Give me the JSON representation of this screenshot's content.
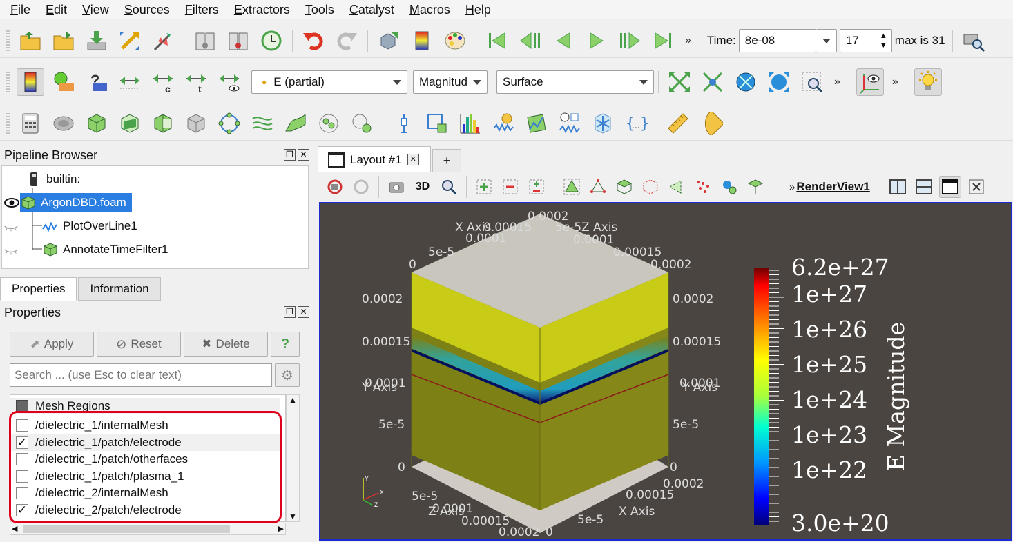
{
  "menu": [
    "File",
    "Edit",
    "View",
    "Sources",
    "Filters",
    "Extractors",
    "Tools",
    "Catalyst",
    "Macros",
    "Help"
  ],
  "time": {
    "label": "Time:",
    "value": "8e-08",
    "index": "17",
    "max": "max is 31"
  },
  "toolbar2": {
    "array": "E (partial)",
    "component": "Magnitud",
    "representation": "Surface"
  },
  "pipeline": {
    "title": "Pipeline Browser",
    "items": [
      "builtin:",
      "ArgonDBD.foam",
      "PlotOverLine1",
      "AnnotateTimeFilter1"
    ]
  },
  "tabs": {
    "properties": "Properties",
    "information": "Information"
  },
  "properties": {
    "title": "Properties",
    "apply": "Apply",
    "reset": "Reset",
    "delete": "Delete",
    "help": "?",
    "search_placeholder": "Search ... (use Esc to clear text)",
    "mesh_header": "Mesh Regions",
    "regions": [
      {
        "name": "/dielectric_1/internalMesh",
        "checked": false
      },
      {
        "name": "/dielectric_1/patch/electrode",
        "checked": true
      },
      {
        "name": "/dielectric_1/patch/otherfaces",
        "checked": false
      },
      {
        "name": "/dielectric_1/patch/plasma_1",
        "checked": false
      },
      {
        "name": "/dielectric_2/internalMesh",
        "checked": false
      },
      {
        "name": "/dielectric_2/patch/electrode",
        "checked": true
      }
    ]
  },
  "layout": {
    "tab": "Layout #1",
    "plus": "+",
    "mode3d": "3D",
    "view_name": "RenderView1"
  },
  "render": {
    "axes": {
      "x_axis": "X Axis",
      "y_axis": "Y Axis",
      "z_axis": "Z Axis",
      "ticks_top_left": [
        "0",
        "5e-5",
        "0.0001",
        "0.00015",
        "0.0002"
      ],
      "ticks_top_right": [
        "5e-5",
        "0.0001",
        "0.00015",
        "0.0002"
      ],
      "ticks_left": [
        "0.0002",
        "0.00015",
        "0.0001",
        "5e-5",
        "0"
      ],
      "ticks_right": [
        "0.0002",
        "0.00015",
        "0.0001",
        "5e-5",
        "0"
      ],
      "ticks_bottom_left": [
        "5e-5",
        "0.0001",
        "0.00015",
        "0.0002"
      ],
      "ticks_bottom_right": [
        "0",
        "5e-5",
        "0.00015",
        "0.0002"
      ],
      "triad": {
        "x": "X",
        "y": "Y",
        "z": "Z"
      }
    },
    "colorbar": {
      "title": "E Magnitude",
      "max": "6.2e+27",
      "min": "3.0e+20",
      "labels": [
        "1e+27",
        "1e+26",
        "1e+25",
        "1e+24",
        "1e+23",
        "1e+22"
      ]
    },
    "colors": {
      "background": "#4a4541",
      "body": "#7d8014",
      "top_band": "#c8cc16",
      "cap": "#c9c6be",
      "frame": "#1c2bd1"
    }
  }
}
